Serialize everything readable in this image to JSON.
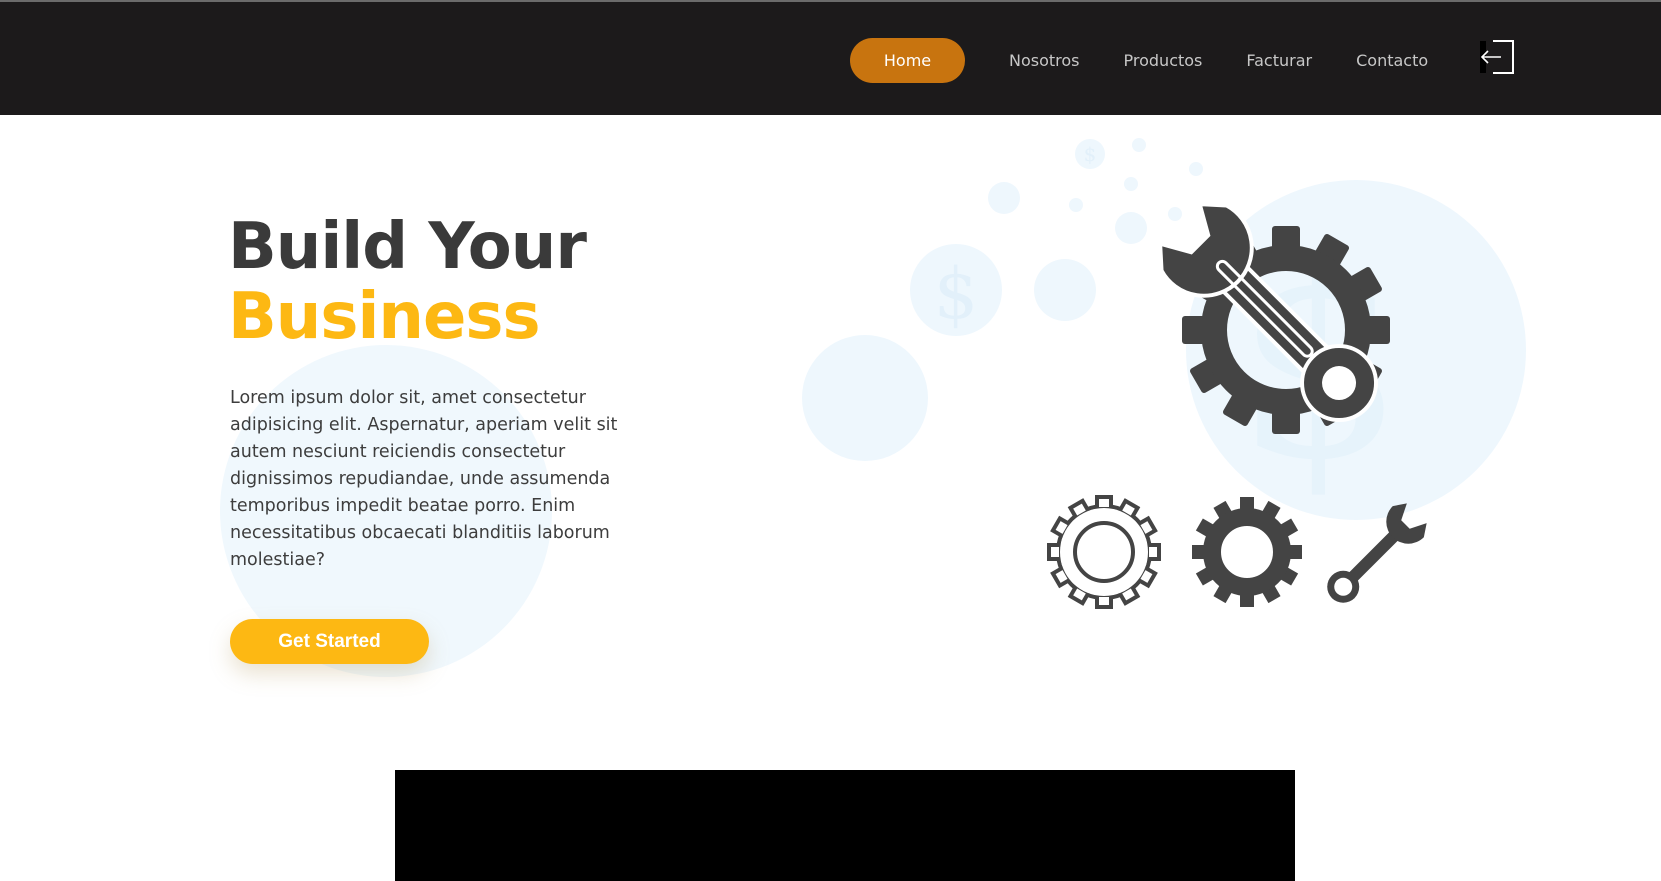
{
  "nav": {
    "links": [
      {
        "label": "Home",
        "active": true
      },
      {
        "label": "Nosotros",
        "active": false
      },
      {
        "label": "Productos",
        "active": false
      },
      {
        "label": "Facturar",
        "active": false
      },
      {
        "label": "Contacto",
        "active": false
      }
    ],
    "logout_icon": "logout-icon"
  },
  "hero": {
    "title_line1": "Build Your",
    "title_line2": "Business",
    "text": "Lorem ipsum dolor sit, amet consectetur adipisicing elit. Aspernatur, aperiam velit sit autem nesciunt reiciendis consectetur dignissimos repudiandae, unde assumenda temporibus impedit beatae porro. Enim necessitatibus obcaecati blanditiis laborum molestiae?",
    "cta_label": "Get Started"
  },
  "colors": {
    "navbar_bg": "#1c1a1b",
    "active_nav": "#c8740f",
    "accent": "#fdb813",
    "heading": "#3a3a3a",
    "icon": "#444444",
    "bubble": "#eef7fd"
  },
  "illustration": {
    "icons": [
      "wrench-gear-icon",
      "gear-outline-icon",
      "gear-icon",
      "wrench-icon",
      "dollar-icon"
    ]
  }
}
